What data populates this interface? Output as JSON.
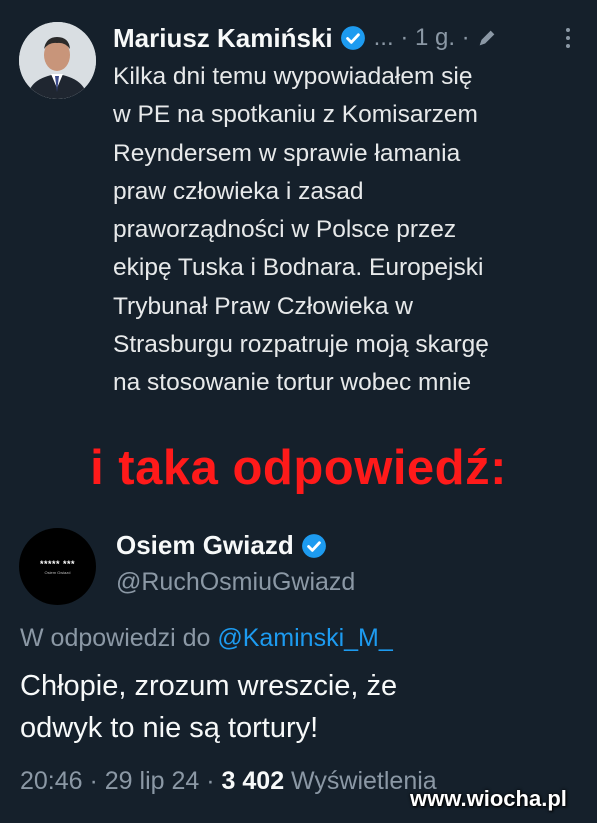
{
  "tweet": {
    "author": "Mariusz Kamiński",
    "meta": "... · 1 g. ·",
    "text": "Kilka dni temu wypowiadałem się\nw PE na spotkaniu z Komisarzem\nReyndersem w sprawie łamania\npraw człowieka i zasad\npraworządności w Polsce przez\nekipę Tuska i Bodnara. Europejski\nTrybunał Praw Człowieka w\nStrasburgu rozpatruje moją skargę\nna stosowanie tortur wobec mnie"
  },
  "headline": "i taka odpowiedź:",
  "reply": {
    "author": "Osiem Gwiazd",
    "handle": "@RuchOsmiuGwiazd",
    "avatar_text": "***** ***",
    "avatar_subtext": "Osiem Gwiazd",
    "reply_to_label": "W odpowiedzi do",
    "reply_to_mention": "@Kaminski_M_",
    "text": "Chłopie, zrozum wreszcie, że\nodwyk to nie są tortury!",
    "time": "20:46 · 29 lip 24 ·",
    "views_count": "3 402",
    "views_label": "Wyświetlenia"
  },
  "watermark": "www.wiocha.pl",
  "colors": {
    "background": "#15202b",
    "verified": "#1d9bf0",
    "headline": "#ff1a1a",
    "mention": "#1d9bf0"
  }
}
